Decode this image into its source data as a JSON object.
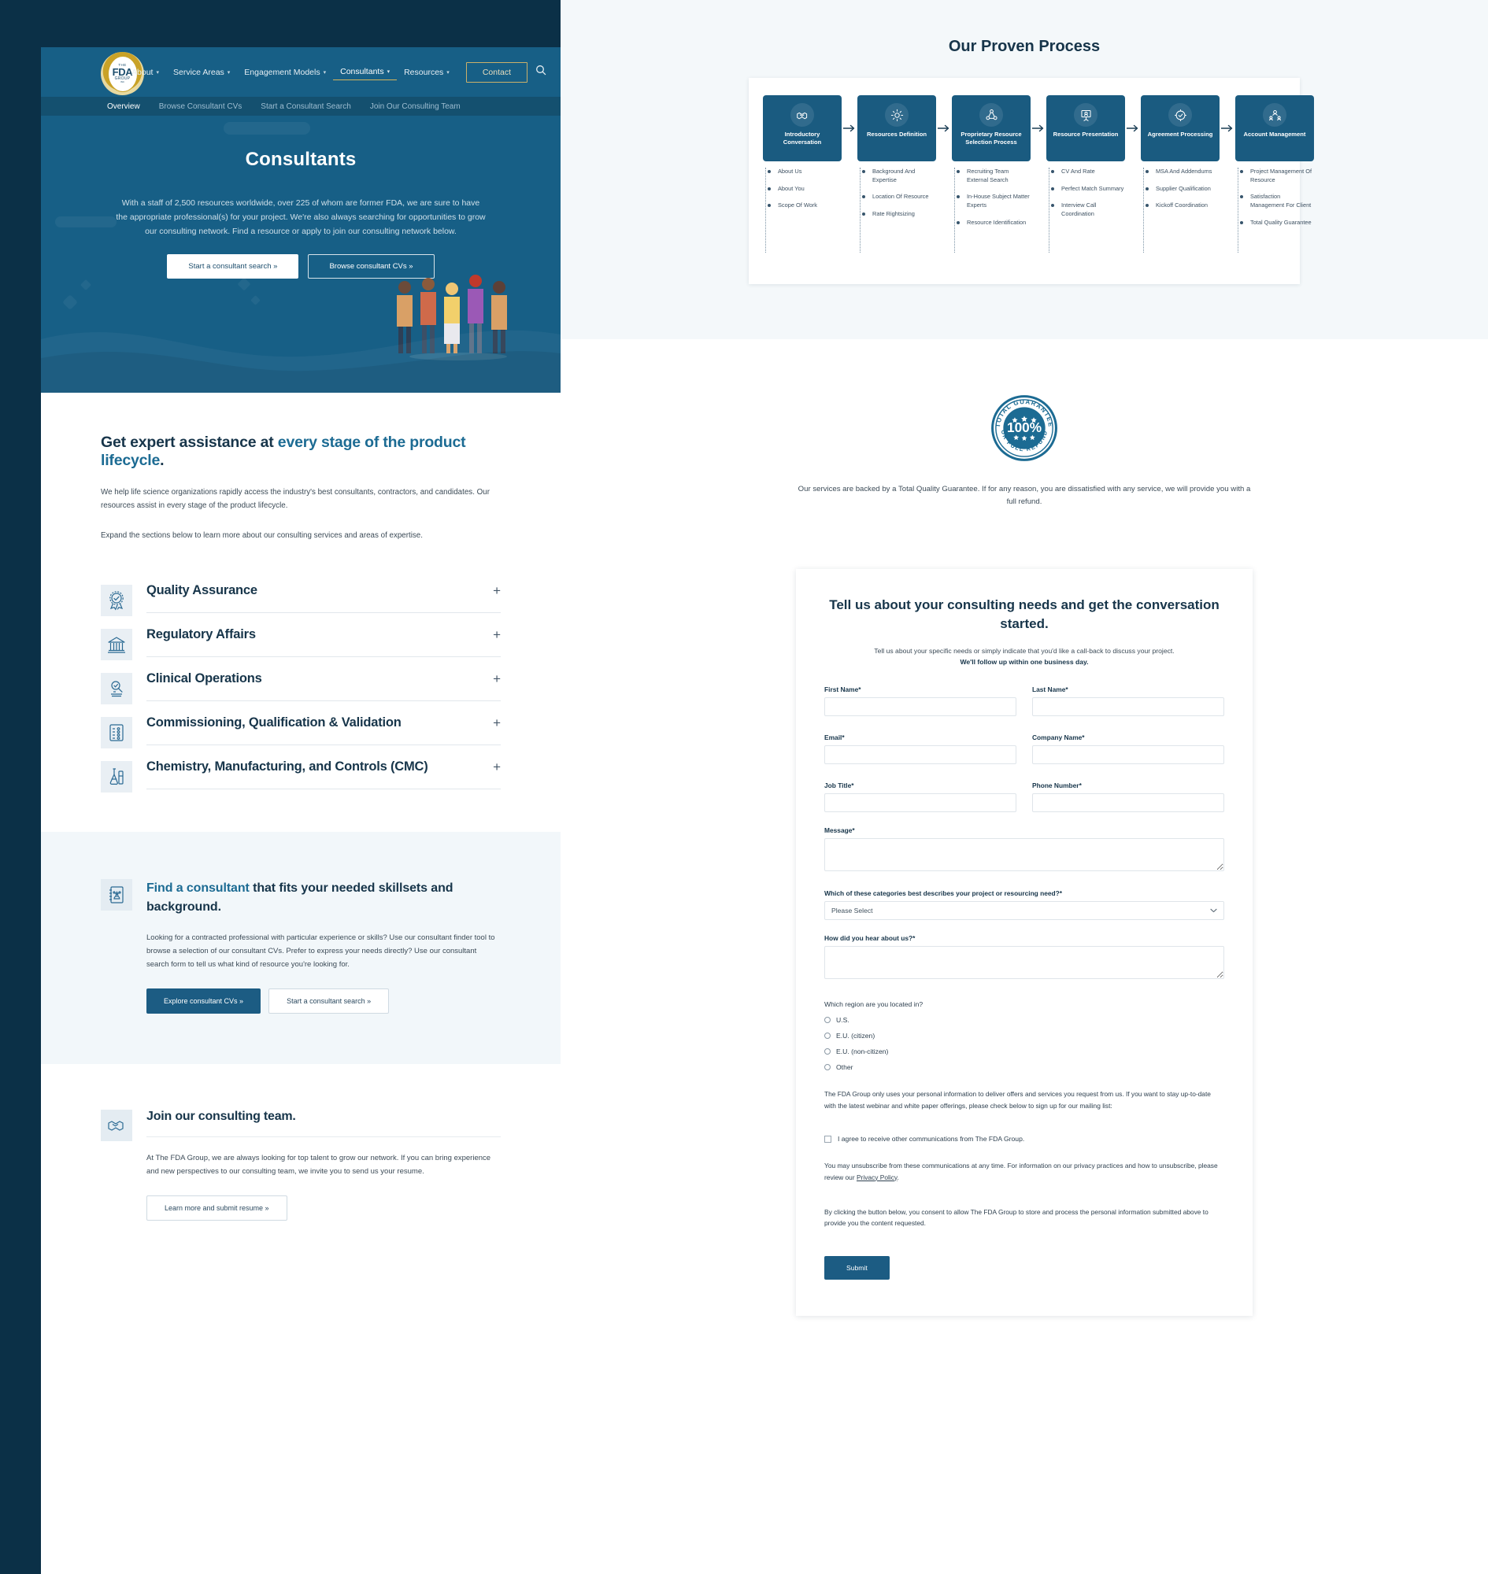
{
  "header": {
    "logo": {
      "the": "THE",
      "fda": "FDA",
      "group": "GROUP",
      "inc": "INC"
    },
    "nav": [
      {
        "label": "About",
        "caret": "chevron-down-icon"
      },
      {
        "label": "Service Areas",
        "caret": "chevron-down-icon"
      },
      {
        "label": "Engagement Models",
        "caret": "chevron-down-icon"
      },
      {
        "label": "Consultants",
        "caret": "chevron-down-icon"
      },
      {
        "label": "Resources",
        "caret": "chevron-down-icon"
      }
    ],
    "contact_label": "Contact",
    "search_icon": "search-icon",
    "subnav": [
      {
        "label": "Overview"
      },
      {
        "label": "Browse Consultant CVs"
      },
      {
        "label": "Start a Consultant Search"
      },
      {
        "label": "Join Our Consulting Team"
      }
    ]
  },
  "hero": {
    "title": "Consultants",
    "paragraph": "With a staff of 2,500 resources worldwide, over 225 of whom are former FDA, we are sure to have the appropriate professional(s) for your project. We're also always searching for opportunities to grow our consulting network. Find a resource or apply to join our consulting network below.",
    "btn_primary": "Start a consultant search »",
    "btn_secondary": "Browse consultant CVs »"
  },
  "lifecycle": {
    "heading_plain": "Get expert assistance at ",
    "heading_accent": "every stage of the product lifecycle",
    "heading_period": ".",
    "paragraph1": "We help life science organizations rapidly access the industry's best consultants, contractors, and candidates. Our resources assist in every stage of the product lifecycle.",
    "paragraph2": "Expand the sections below to learn more about our consulting services and areas of expertise.",
    "accordion": [
      {
        "title": "Quality Assurance",
        "icon": "award-ribbon-icon",
        "toggle": "+"
      },
      {
        "title": "Regulatory Affairs",
        "icon": "government-building-icon",
        "toggle": "+"
      },
      {
        "title": "Clinical Operations",
        "icon": "microscope-icon",
        "toggle": "+"
      },
      {
        "title": "Commissioning, Qualification & Validation",
        "icon": "checklist-icon",
        "toggle": "+"
      },
      {
        "title": "Chemistry, Manufacturing, and Controls (CMC)",
        "icon": "flask-icon",
        "toggle": "+"
      }
    ]
  },
  "find_consultant": {
    "icon": "contact-book-icon",
    "heading_accent": "Find a consultant",
    "heading_plain": " that fits your needed skillsets and background.",
    "paragraph": "Looking for a contracted professional with particular experience or skills? Use our consultant finder tool to browse a selection of our consultant CVs. Prefer to express your needs directly? Use our consultant search form to tell us what kind of resource you're looking for.",
    "btn_primary": "Explore consultant CVs »",
    "btn_secondary": "Start a consultant search »"
  },
  "join_team": {
    "icon": "handshake-icon",
    "heading": "Join our consulting team.",
    "paragraph": "At The FDA Group, we are always looking for top talent to grow our network. If you can bring experience and new perspectives to our consulting team, we invite you to send us your resume.",
    "btn": "Learn more and submit resume »"
  },
  "process": {
    "title": "Our Proven Process",
    "steps": [
      {
        "label": "Introductory Conversation",
        "icon": "handshake-icon",
        "bullets": [
          "About Us",
          "About You",
          "Scope Of Work"
        ]
      },
      {
        "label": "Resources Definition",
        "icon": "gear-icon",
        "bullets": [
          "Background And Expertise",
          "Location Of Resource",
          "Rate Rightsizing"
        ]
      },
      {
        "label": "Proprietary Resource Selection Process",
        "icon": "network-people-icon",
        "bullets": [
          "Recruiting Team External Search",
          "In-House Subject Matter Experts",
          "Resource Identification"
        ]
      },
      {
        "label": "Resource Presentation",
        "icon": "presentation-person-icon",
        "bullets": [
          "CV And Rate",
          "Perfect Match Summary",
          "Interview Call Coordination"
        ]
      },
      {
        "label": "Agreement Processing",
        "icon": "document-check-icon",
        "bullets": [
          "MSA And Addendums",
          "Supplier Qualification",
          "Kickoff Coordination"
        ]
      },
      {
        "label": "Account Management",
        "icon": "account-users-icon",
        "bullets": [
          "Project Management Of Resource",
          "Satisfaction Management For Client",
          "Total Quality Guarantee"
        ]
      }
    ]
  },
  "guarantee": {
    "badge": {
      "top_text": "TOTAL GUARANTEE",
      "value": "100%",
      "bottom_text": "OR FULL REFUND",
      "color": "#1c6b93"
    },
    "text": "Our services are backed by a Total Quality Guarantee. If for any reason, you are dissatisfied with any service, we will provide you with a full refund."
  },
  "form": {
    "title": "Tell us about your consulting needs and get the conversation started.",
    "sub_lead": "Tell us about your specific needs or simply indicate that you'd like a call-back to discuss your project.",
    "sub_bold": "We'll follow up within one business day.",
    "fields": {
      "first_name": {
        "label": "First Name",
        "req": "*",
        "value": ""
      },
      "last_name": {
        "label": "Last Name",
        "req": "*",
        "value": ""
      },
      "email": {
        "label": "Email",
        "req": "*",
        "value": ""
      },
      "company_name": {
        "label": "Company Name",
        "req": "*",
        "value": ""
      },
      "job_title": {
        "label": "Job Title",
        "req": "*",
        "value": ""
      },
      "phone_number": {
        "label": "Phone Number",
        "req": "*",
        "value": ""
      },
      "message": {
        "label": "Message",
        "req": "*",
        "value": ""
      },
      "category": {
        "label": "Which of these categories best describes your project or resourcing need?",
        "req": "*",
        "selected": "Please Select",
        "caret": "chevron-down-icon"
      },
      "how_heard": {
        "label": "How did you hear about us?",
        "req": "*",
        "value": ""
      }
    },
    "region": {
      "question": "Which region are you located in?",
      "options": [
        "U.S.",
        "E.U. (citizen)",
        "E.U. (non-citizen)",
        "Other"
      ]
    },
    "legal_1": "The FDA Group only uses your personal information to deliver offers and services you request from us. If you want to stay up-to-date with the latest webinar and white paper offerings, please check below to sign up for our mailing list:",
    "consent_checkbox_label": "I agree to receive other communications from The FDA Group.",
    "legal_2_pre": "You may unsubscribe from these communications at any time. For information on our privacy practices and how to unsubscribe, please review our ",
    "legal_2_link": "Privacy Policy",
    "legal_2_post": ".",
    "legal_3": "By clicking the button below, you consent to allow The FDA Group to store and process the personal information submitted above to provide you the content requested.",
    "submit_label": "Submit"
  }
}
